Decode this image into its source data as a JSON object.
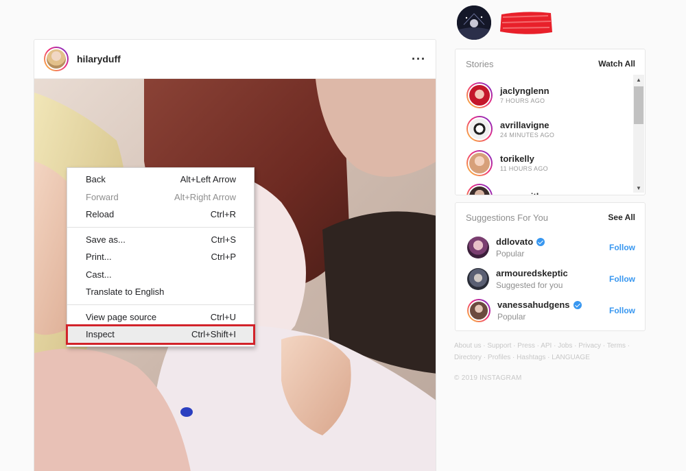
{
  "post": {
    "username": "hilaryduff",
    "more_icon": "more-horizontal-icon"
  },
  "context_menu": {
    "groups": [
      [
        {
          "label": "Back",
          "shortcut": "Alt+Left Arrow",
          "disabled": false
        },
        {
          "label": "Forward",
          "shortcut": "Alt+Right Arrow",
          "disabled": true
        },
        {
          "label": "Reload",
          "shortcut": "Ctrl+R",
          "disabled": false
        }
      ],
      [
        {
          "label": "Save as...",
          "shortcut": "Ctrl+S",
          "disabled": false
        },
        {
          "label": "Print...",
          "shortcut": "Ctrl+P",
          "disabled": false
        },
        {
          "label": "Cast...",
          "shortcut": "",
          "disabled": false
        },
        {
          "label": "Translate to English",
          "shortcut": "",
          "disabled": false
        }
      ],
      [
        {
          "label": "View page source",
          "shortcut": "Ctrl+U",
          "disabled": false
        },
        {
          "label": "Inspect",
          "shortcut": "Ctrl+Shift+I",
          "disabled": false,
          "highlighted": true
        }
      ]
    ],
    "highlight_color": "#d2232a"
  },
  "stories": {
    "title": "Stories",
    "action": "Watch All",
    "items": [
      {
        "name": "jaclynglenn",
        "time": "7 HOURS AGO"
      },
      {
        "name": "avrillavigne",
        "time": "24 MINUTES AGO"
      },
      {
        "name": "torikelly",
        "time": "11 HOURS AGO"
      },
      {
        "name": "samsmith",
        "time": ""
      }
    ]
  },
  "suggestions": {
    "title": "Suggestions For You",
    "action": "See All",
    "items": [
      {
        "name": "ddlovato",
        "sub": "Popular",
        "verified": true,
        "follow": "Follow"
      },
      {
        "name": "armouredskeptic",
        "sub": "Suggested for you",
        "verified": false,
        "follow": "Follow"
      },
      {
        "name": "vanessahudgens",
        "sub": "Popular",
        "verified": true,
        "follow": "Follow"
      }
    ]
  },
  "footer": {
    "links": [
      "About us",
      "Support",
      "Press",
      "API",
      "Jobs",
      "Privacy",
      "Terms",
      "Directory",
      "Profiles",
      "Hashtags",
      "LANGUAGE"
    ],
    "copyright": "© 2019 INSTAGRAM"
  },
  "colors": {
    "accent_blue": "#3897f0",
    "redaction": "#e8202a",
    "story_ring": "#ee2a7b"
  }
}
